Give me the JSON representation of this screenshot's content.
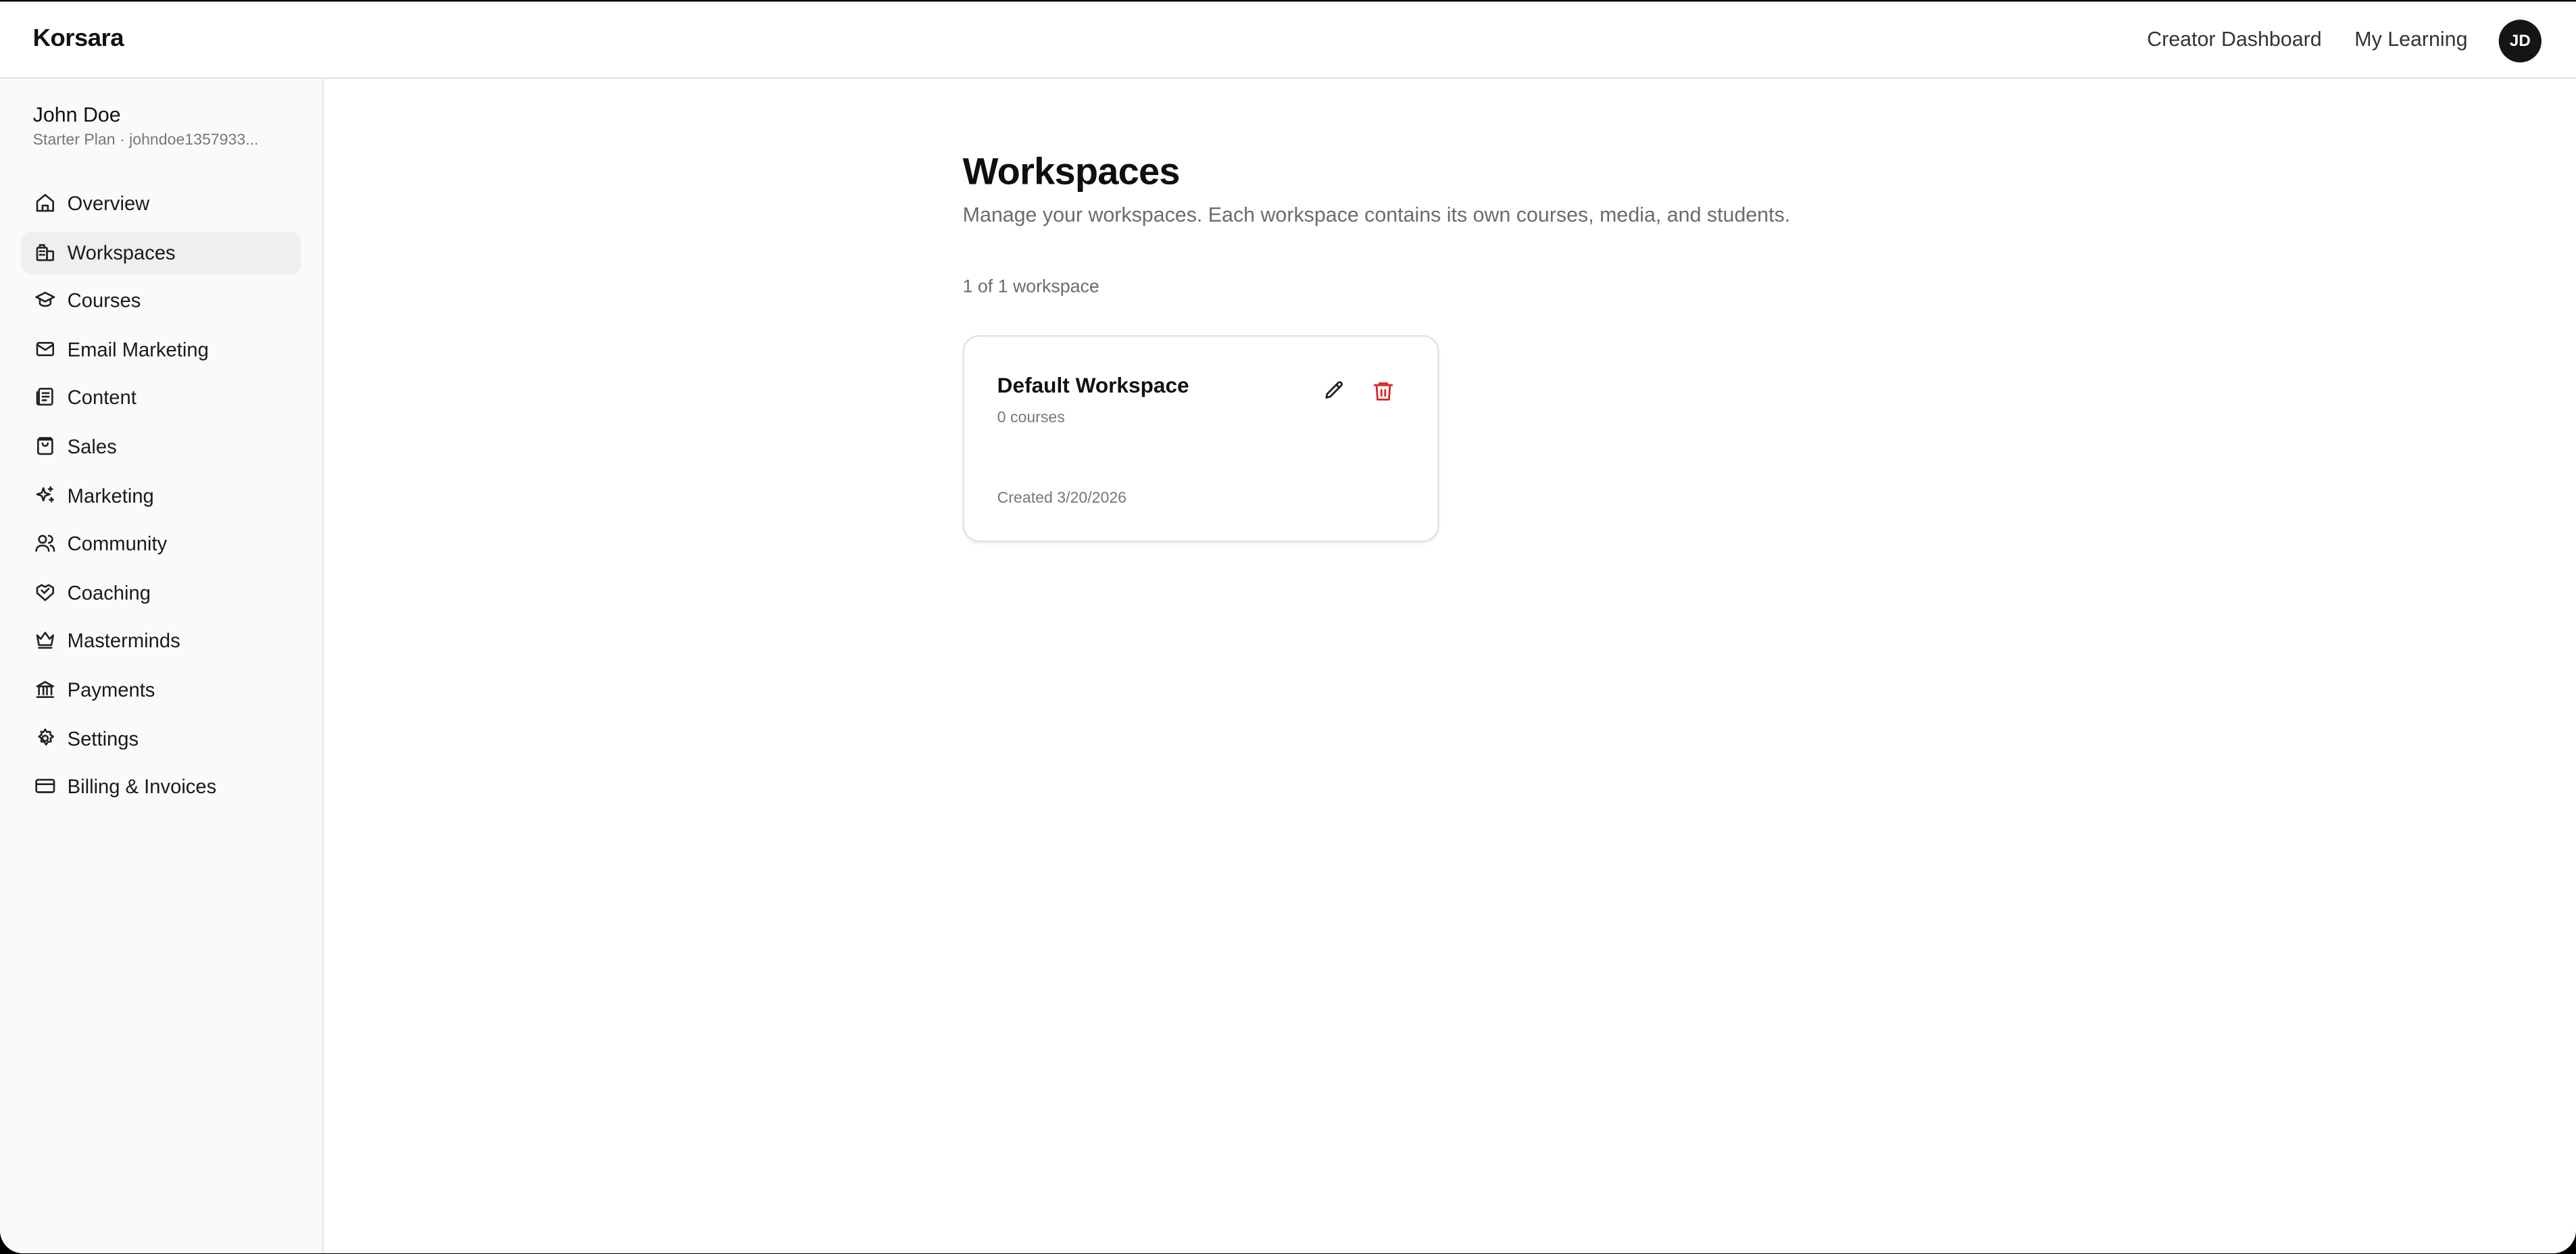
{
  "header": {
    "brand": "Korsara",
    "nav": [
      "Creator Dashboard",
      "My Learning"
    ],
    "avatar_initials": "JD"
  },
  "sidebar": {
    "user_name": "John Doe",
    "user_plan": "Starter Plan · johndoe1357933...",
    "items": [
      {
        "label": "Overview",
        "icon": "home-icon"
      },
      {
        "label": "Workspaces",
        "icon": "building-icon",
        "active": true
      },
      {
        "label": "Courses",
        "icon": "graduation-cap-icon"
      },
      {
        "label": "Email Marketing",
        "icon": "mail-icon"
      },
      {
        "label": "Content",
        "icon": "newspaper-icon"
      },
      {
        "label": "Sales",
        "icon": "shopping-bag-icon"
      },
      {
        "label": "Marketing",
        "icon": "sparkles-icon"
      },
      {
        "label": "Community",
        "icon": "users-icon"
      },
      {
        "label": "Coaching",
        "icon": "handshake-icon"
      },
      {
        "label": "Masterminds",
        "icon": "crown-icon"
      },
      {
        "label": "Payments",
        "icon": "bank-icon"
      },
      {
        "label": "Settings",
        "icon": "gear-icon"
      },
      {
        "label": "Billing & Invoices",
        "icon": "credit-card-icon"
      }
    ]
  },
  "main": {
    "title": "Workspaces",
    "subtitle": "Manage your workspaces. Each workspace contains its own courses, media, and students.",
    "count": "1 of 1 workspace",
    "workspaces": [
      {
        "name": "Default Workspace",
        "courses": "0 courses",
        "created": "Created 3/20/2026"
      }
    ]
  },
  "colors": {
    "accent_dark": "#151515",
    "delete_red": "#dc2626",
    "muted_text": "#6b6b6b",
    "sidebar_bg": "#fafafa",
    "active_item_bg": "#efefef"
  }
}
